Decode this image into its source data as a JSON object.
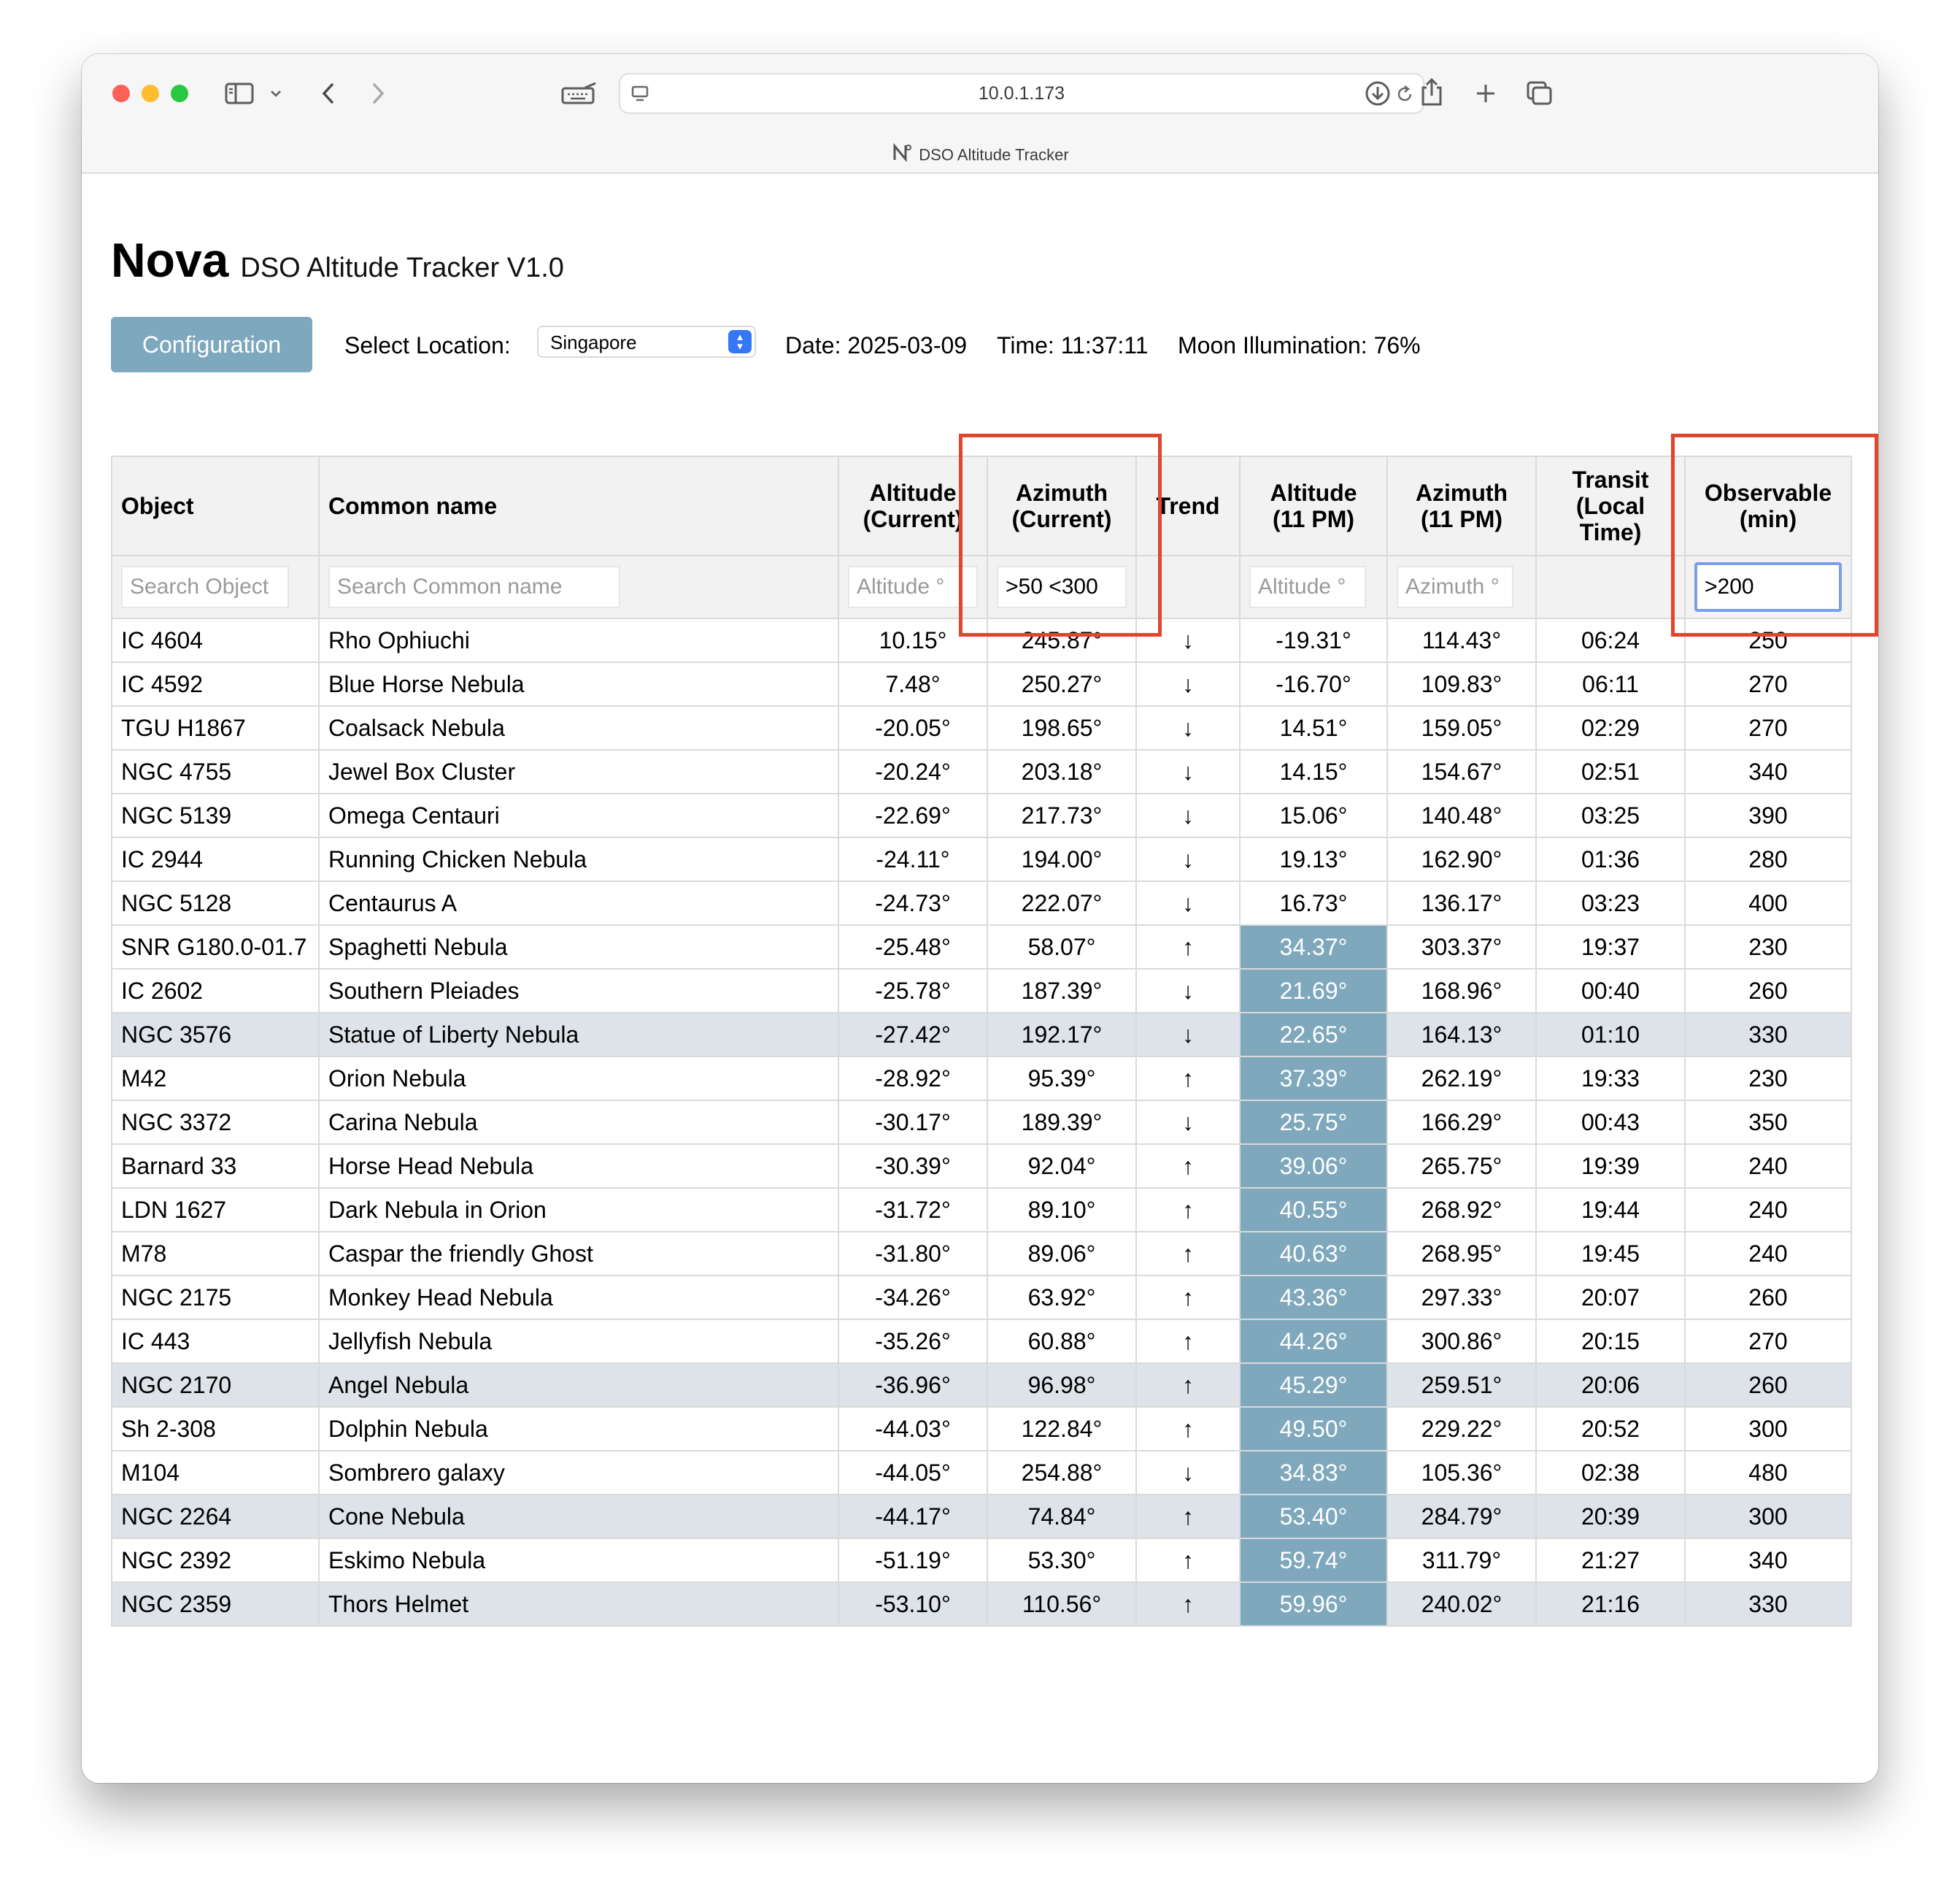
{
  "browser": {
    "url": "10.0.1.173",
    "tab_title": "DSO Altitude Tracker"
  },
  "app": {
    "brand": "Nova",
    "subtitle": "DSO Altitude Tracker V1.0",
    "config_button": "Configuration",
    "location_label": "Select Location:",
    "location_value": "Singapore",
    "date_text": "Date: 2025-03-09",
    "time_text": "Time: 11:37:11",
    "moon_text": "Moon Illumination: 76%"
  },
  "table": {
    "headers": {
      "object": "Object",
      "common": "Common name",
      "alt_cur_1": "Altitude",
      "alt_cur_2": "(Current)",
      "az_cur_1": "Azimuth",
      "az_cur_2": "(Current)",
      "trend": "Trend",
      "alt_11_1": "Altitude",
      "alt_11_2": "(11 PM)",
      "az_11_1": "Azimuth",
      "az_11_2": "(11 PM)",
      "transit_1": "Transit",
      "transit_2": "(Local",
      "transit_3": "Time)",
      "obs_1": "Observable",
      "obs_2": "(min)"
    },
    "filters": {
      "object_placeholder": "Search Object",
      "common_placeholder": "Search Common name",
      "alt_cur_placeholder": "Altitude °",
      "az_cur_value": ">50 <300",
      "alt_11_placeholder": "Altitude °",
      "az_11_placeholder": "Azimuth °",
      "observable_value": ">200"
    },
    "highlight_color": "#7fa8bc",
    "alt_row_color": "#dde3e8",
    "annotation_color": "#e2452e",
    "rows": [
      {
        "object": "IC 4604",
        "common": "Rho Ophiuchi",
        "alt": "10.15°",
        "az": "245.87°",
        "trend": "↓",
        "alt11": "-19.31°",
        "az11": "114.43°",
        "transit": "06:24",
        "obs": "250",
        "hl": false,
        "alt_row": false
      },
      {
        "object": "IC 4592",
        "common": "Blue Horse Nebula",
        "alt": "7.48°",
        "az": "250.27°",
        "trend": "↓",
        "alt11": "-16.70°",
        "az11": "109.83°",
        "transit": "06:11",
        "obs": "270",
        "hl": false,
        "alt_row": false
      },
      {
        "object": "TGU H1867",
        "common": "Coalsack Nebula",
        "alt": "-20.05°",
        "az": "198.65°",
        "trend": "↓",
        "alt11": "14.51°",
        "az11": "159.05°",
        "transit": "02:29",
        "obs": "270",
        "hl": false,
        "alt_row": false
      },
      {
        "object": "NGC 4755",
        "common": "Jewel Box Cluster",
        "alt": "-20.24°",
        "az": "203.18°",
        "trend": "↓",
        "alt11": "14.15°",
        "az11": "154.67°",
        "transit": "02:51",
        "obs": "340",
        "hl": false,
        "alt_row": false
      },
      {
        "object": "NGC 5139",
        "common": "Omega Centauri",
        "alt": "-22.69°",
        "az": "217.73°",
        "trend": "↓",
        "alt11": "15.06°",
        "az11": "140.48°",
        "transit": "03:25",
        "obs": "390",
        "hl": false,
        "alt_row": false
      },
      {
        "object": "IC 2944",
        "common": "Running Chicken Nebula",
        "alt": "-24.11°",
        "az": "194.00°",
        "trend": "↓",
        "alt11": "19.13°",
        "az11": "162.90°",
        "transit": "01:36",
        "obs": "280",
        "hl": false,
        "alt_row": false
      },
      {
        "object": "NGC 5128",
        "common": "Centaurus A",
        "alt": "-24.73°",
        "az": "222.07°",
        "trend": "↓",
        "alt11": "16.73°",
        "az11": "136.17°",
        "transit": "03:23",
        "obs": "400",
        "hl": false,
        "alt_row": false
      },
      {
        "object": "SNR G180.0-01.7",
        "common": "Spaghetti Nebula",
        "alt": "-25.48°",
        "az": "58.07°",
        "trend": "↑",
        "alt11": "34.37°",
        "az11": "303.37°",
        "transit": "19:37",
        "obs": "230",
        "hl": true,
        "alt_row": false
      },
      {
        "object": "IC 2602",
        "common": "Southern Pleiades",
        "alt": "-25.78°",
        "az": "187.39°",
        "trend": "↓",
        "alt11": "21.69°",
        "az11": "168.96°",
        "transit": "00:40",
        "obs": "260",
        "hl": true,
        "alt_row": false
      },
      {
        "object": "NGC 3576",
        "common": "Statue of Liberty Nebula",
        "alt": "-27.42°",
        "az": "192.17°",
        "trend": "↓",
        "alt11": "22.65°",
        "az11": "164.13°",
        "transit": "01:10",
        "obs": "330",
        "hl": true,
        "alt_row": true
      },
      {
        "object": "M42",
        "common": "Orion Nebula",
        "alt": "-28.92°",
        "az": "95.39°",
        "trend": "↑",
        "alt11": "37.39°",
        "az11": "262.19°",
        "transit": "19:33",
        "obs": "230",
        "hl": true,
        "alt_row": false
      },
      {
        "object": "NGC 3372",
        "common": "Carina Nebula",
        "alt": "-30.17°",
        "az": "189.39°",
        "trend": "↓",
        "alt11": "25.75°",
        "az11": "166.29°",
        "transit": "00:43",
        "obs": "350",
        "hl": true,
        "alt_row": false
      },
      {
        "object": "Barnard 33",
        "common": "Horse Head Nebula",
        "alt": "-30.39°",
        "az": "92.04°",
        "trend": "↑",
        "alt11": "39.06°",
        "az11": "265.75°",
        "transit": "19:39",
        "obs": "240",
        "hl": true,
        "alt_row": false
      },
      {
        "object": "LDN 1627",
        "common": "Dark Nebula in Orion",
        "alt": "-31.72°",
        "az": "89.10°",
        "trend": "↑",
        "alt11": "40.55°",
        "az11": "268.92°",
        "transit": "19:44",
        "obs": "240",
        "hl": true,
        "alt_row": false
      },
      {
        "object": "M78",
        "common": "Caspar the friendly Ghost",
        "alt": "-31.80°",
        "az": "89.06°",
        "trend": "↑",
        "alt11": "40.63°",
        "az11": "268.95°",
        "transit": "19:45",
        "obs": "240",
        "hl": true,
        "alt_row": false
      },
      {
        "object": "NGC 2175",
        "common": "Monkey Head Nebula",
        "alt": "-34.26°",
        "az": "63.92°",
        "trend": "↑",
        "alt11": "43.36°",
        "az11": "297.33°",
        "transit": "20:07",
        "obs": "260",
        "hl": true,
        "alt_row": false
      },
      {
        "object": "IC 443",
        "common": "Jellyfish Nebula",
        "alt": "-35.26°",
        "az": "60.88°",
        "trend": "↑",
        "alt11": "44.26°",
        "az11": "300.86°",
        "transit": "20:15",
        "obs": "270",
        "hl": true,
        "alt_row": false
      },
      {
        "object": "NGC 2170",
        "common": "Angel Nebula",
        "alt": "-36.96°",
        "az": "96.98°",
        "trend": "↑",
        "alt11": "45.29°",
        "az11": "259.51°",
        "transit": "20:06",
        "obs": "260",
        "hl": true,
        "alt_row": true
      },
      {
        "object": "Sh 2-308",
        "common": "Dolphin Nebula",
        "alt": "-44.03°",
        "az": "122.84°",
        "trend": "↑",
        "alt11": "49.50°",
        "az11": "229.22°",
        "transit": "20:52",
        "obs": "300",
        "hl": true,
        "alt_row": false
      },
      {
        "object": "M104",
        "common": "Sombrero galaxy",
        "alt": "-44.05°",
        "az": "254.88°",
        "trend": "↓",
        "alt11": "34.83°",
        "az11": "105.36°",
        "transit": "02:38",
        "obs": "480",
        "hl": true,
        "alt_row": false
      },
      {
        "object": "NGC 2264",
        "common": "Cone Nebula",
        "alt": "-44.17°",
        "az": "74.84°",
        "trend": "↑",
        "alt11": "53.40°",
        "az11": "284.79°",
        "transit": "20:39",
        "obs": "300",
        "hl": true,
        "alt_row": true
      },
      {
        "object": "NGC 2392",
        "common": "Eskimo Nebula",
        "alt": "-51.19°",
        "az": "53.30°",
        "trend": "↑",
        "alt11": "59.74°",
        "az11": "311.79°",
        "transit": "21:27",
        "obs": "340",
        "hl": true,
        "alt_row": false
      },
      {
        "object": "NGC 2359",
        "common": "Thors Helmet",
        "alt": "-53.10°",
        "az": "110.56°",
        "trend": "↑",
        "alt11": "59.96°",
        "az11": "240.02°",
        "transit": "21:16",
        "obs": "330",
        "hl": true,
        "alt_row": true
      }
    ]
  }
}
